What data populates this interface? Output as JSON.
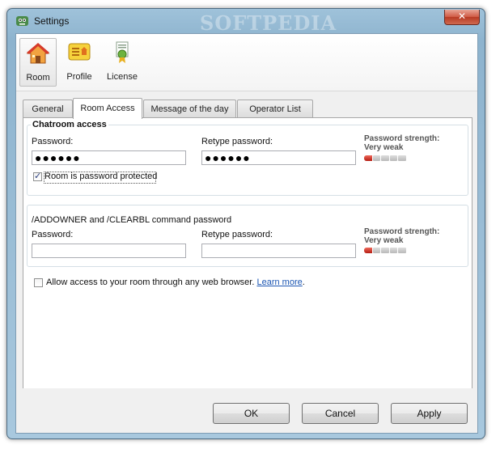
{
  "window": {
    "title": "Settings",
    "close_label": "✕",
    "watermark": "SOFTPEDIA"
  },
  "toolbar": {
    "items": [
      {
        "label": "Room",
        "icon": "house-icon"
      },
      {
        "label": "Profile",
        "icon": "profile-card-icon"
      },
      {
        "label": "License",
        "icon": "certificate-icon"
      }
    ],
    "selected": "Room"
  },
  "tabs": [
    {
      "label": "General"
    },
    {
      "label": "Room Access"
    },
    {
      "label": "Message of the day"
    },
    {
      "label": "Operator List"
    }
  ],
  "active_tab": "Room Access",
  "chatroom": {
    "title": "Chatroom access",
    "password_label": "Password:",
    "password_value": "●●●●●●",
    "retype_label": "Retype password:",
    "retype_value": "●●●●●●",
    "strength_label": "Password strength:",
    "strength_value": "Very weak",
    "protected_label": "Room is password protected",
    "protected_checked": true
  },
  "addowner": {
    "title": "/ADDOWNER and /CLEARBL command password",
    "password_label": "Password:",
    "password_value": "",
    "retype_label": "Retype password:",
    "retype_value": "",
    "strength_label": "Password strength:",
    "strength_value": "Very weak"
  },
  "web_access": {
    "label": "Allow access to your room through any web browser.",
    "link": "Learn more",
    "link_suffix": ".",
    "checked": false
  },
  "buttons": {
    "ok": "OK",
    "cancel": "Cancel",
    "apply": "Apply"
  },
  "colors": {
    "strength_weak": "#c0281a",
    "link": "#1c56b3"
  }
}
